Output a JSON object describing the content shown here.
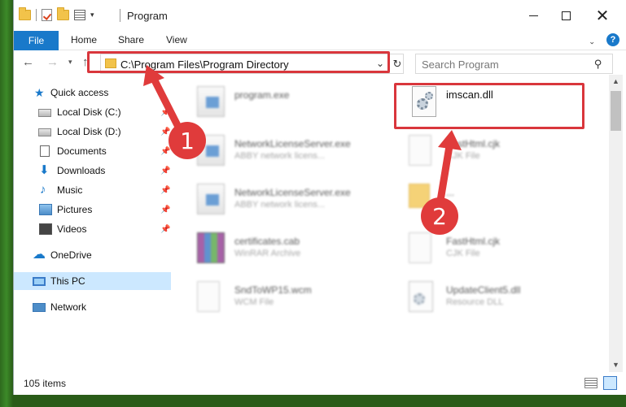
{
  "window": {
    "title": "Program",
    "minimize": "—",
    "maximize": "☐",
    "close": "✕"
  },
  "ribbon": {
    "tabs": [
      "File",
      "Home",
      "Share",
      "View"
    ],
    "help": "?"
  },
  "navigation": {
    "back": "←",
    "forward": "→",
    "recent": "⌄",
    "up": "↑",
    "address": "C:\\Program Files\\Program Directory",
    "refresh": "↻",
    "search_placeholder": "Search Program"
  },
  "sidebar": {
    "items": [
      {
        "label": "Quick access",
        "icon": "star-icon"
      },
      {
        "label": "Local Disk (C:)",
        "icon": "disk-icon",
        "pinned": true
      },
      {
        "label": "Local Disk (D:)",
        "icon": "disk-icon",
        "pinned": true
      },
      {
        "label": "Documents",
        "icon": "documents-icon",
        "pinned": true
      },
      {
        "label": "Downloads",
        "icon": "downloads-icon",
        "pinned": true
      },
      {
        "label": "Music",
        "icon": "music-icon",
        "pinned": true
      },
      {
        "label": "Pictures",
        "icon": "pictures-icon",
        "pinned": true
      },
      {
        "label": "Videos",
        "icon": "videos-icon",
        "pinned": true
      },
      {
        "label": "OneDrive",
        "icon": "onedrive-icon"
      },
      {
        "label": "This PC",
        "icon": "this-pc-icon",
        "selected": true
      },
      {
        "label": "Network",
        "icon": "network-icon"
      }
    ]
  },
  "files": {
    "left": [
      {
        "name": "program.exe",
        "desc": ""
      },
      {
        "name": "NetworkLicenseServer.exe",
        "desc": "ABBY network licens..."
      },
      {
        "name": "NetworkLicenseServer.exe",
        "desc": "ABBY network licens..."
      },
      {
        "name": "certificates.cab",
        "desc": "WinRAR Archive"
      },
      {
        "name": "SndToWP15.wcm",
        "desc": "WCM File"
      }
    ],
    "right": [
      {
        "name": "imscan.dll",
        "desc": ""
      },
      {
        "name": "FastHtml.cjk",
        "desc": "CJK File"
      },
      {
        "name": "...",
        "desc": ""
      },
      {
        "name": "FastHtml.cjk",
        "desc": "CJK File"
      },
      {
        "name": "UpdateClient5.dll",
        "desc": "Resource DLL"
      }
    ]
  },
  "annotations": {
    "badge1": "1",
    "badge2": "2",
    "color": "#e03b3b"
  },
  "status": {
    "count": "105 items"
  }
}
